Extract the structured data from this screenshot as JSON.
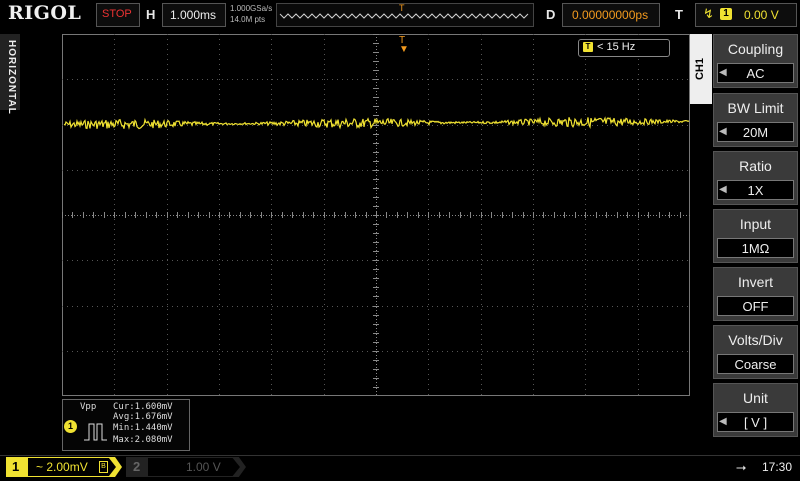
{
  "brand": "RIGOL",
  "top": {
    "status": "STOP",
    "h_label": "H",
    "timebase": "1.000ms",
    "sample_rate": "1.000GSa/s",
    "memory_depth": "14.0M pts",
    "trigger_marker": "T",
    "d_label": "D",
    "delay": "0.00000000ps",
    "t_label": "T",
    "trigger_edge_icon": "rising-edge-icon",
    "trigger_source": "1",
    "trigger_level": "0.00 V"
  },
  "side_label": "HORIZONTAL",
  "screen": {
    "trigger_position_marker": "T",
    "freq_icon": "T",
    "frequency": "< 15 Hz"
  },
  "measurement": {
    "name": "Vpp",
    "channel": "1",
    "cur": "Cur:1.600mV",
    "avg": "Avg:1.676mV",
    "min": "Min:1.440mV",
    "max": "Max:2.080mV"
  },
  "menu": {
    "channel_tab": "CH1",
    "items": [
      {
        "label": "Coupling",
        "value": "AC"
      },
      {
        "label": "BW Limit",
        "value": "20M"
      },
      {
        "label": "Ratio",
        "value": "1X"
      },
      {
        "label": "Input",
        "value": "1MΩ"
      },
      {
        "label": "Invert",
        "value": "OFF"
      },
      {
        "label": "Volts/Div",
        "value": "Coarse"
      },
      {
        "label": "Unit",
        "value": "[  V  ]"
      }
    ]
  },
  "bottom": {
    "ch1_num": "1",
    "ch1_scale": "~ 2.00mV",
    "ch1_bw_mark": "B",
    "ch2_num": "2",
    "ch2_scale": "1.00 V",
    "time": "17:30"
  },
  "colors": {
    "ch1": "#f0e232",
    "trigger": "#f39a1e",
    "stop": "#e33"
  },
  "waveform": {
    "channel": "CH1",
    "level_divisions_above_center": 2.0,
    "noise_peak_to_peak_mV": 1.6
  }
}
